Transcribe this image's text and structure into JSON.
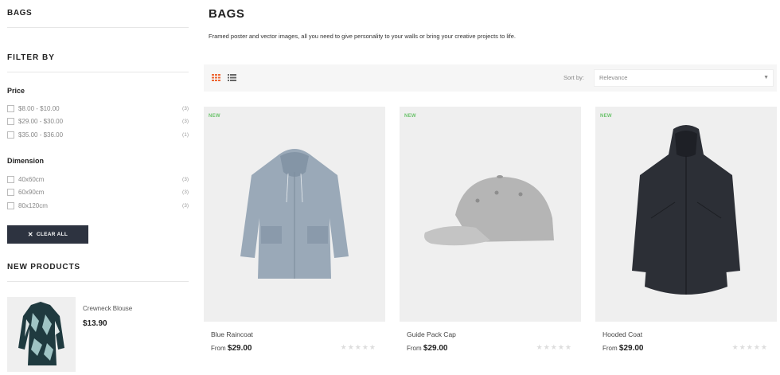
{
  "sidebar": {
    "category_title": "BAGS",
    "filter_title": "FILTER BY",
    "facets": {
      "price": {
        "title": "Price",
        "items": [
          {
            "label": "$8.00 - $10.00",
            "count": "(3)"
          },
          {
            "label": "$29.00 - $30.00",
            "count": "(3)"
          },
          {
            "label": "$35.00 - $36.00",
            "count": "(1)"
          }
        ]
      },
      "dimension": {
        "title": "Dimension",
        "items": [
          {
            "label": "40x60cm",
            "count": "(3)"
          },
          {
            "label": "60x90cm",
            "count": "(3)"
          },
          {
            "label": "80x120cm",
            "count": "(3)"
          }
        ]
      }
    },
    "clear_all_label": "CLEAR ALL",
    "new_products_title": "NEW PRODUCTS",
    "new_product": {
      "name": "Crewneck Blouse",
      "price": "$13.90"
    }
  },
  "main": {
    "title": "BAGS",
    "description": "Framed poster and vector images, all you need to give personality to your walls or bring your creative projects to life.",
    "sort": {
      "label": "Sort by:",
      "value": "Relevance"
    },
    "products": [
      {
        "badge": "NEW",
        "name": "Blue Raincoat",
        "price_prefix": "From",
        "price": "$29.00"
      },
      {
        "badge": "NEW",
        "name": "Guide Pack Cap",
        "price_prefix": "From",
        "price": "$29.00"
      },
      {
        "badge": "NEW",
        "name": "Hooded Coat",
        "price_prefix": "From",
        "price": "$29.00"
      }
    ],
    "rating_stars": "★★★★★"
  },
  "colors": {
    "accent": "#ee6633",
    "new_badge": "#6cc36c",
    "button_dark": "#2d3340"
  },
  "icons": [
    "grid-view-icon",
    "list-view-icon",
    "close-icon",
    "chevron-down-icon",
    "star-icon"
  ]
}
